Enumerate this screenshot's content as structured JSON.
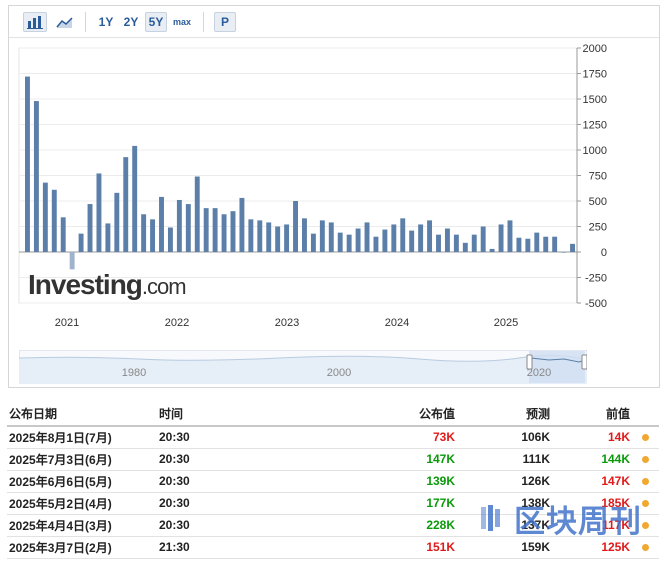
{
  "toolbar": {
    "bar_icon": "bar-chart-icon",
    "area_icon": "area-chart-icon",
    "ranges": [
      "1Y",
      "2Y",
      "5Y",
      "max"
    ],
    "active_range": "5Y",
    "p_label": "P"
  },
  "brand": {
    "name": "Investing",
    "domain": ".com"
  },
  "navigator": {
    "years": [
      "1980",
      "2000",
      "2020"
    ]
  },
  "chart_data": {
    "type": "bar",
    "x_ticks": [
      "2021",
      "2022",
      "2023",
      "2024",
      "2025"
    ],
    "ylim": [
      -500,
      2000
    ],
    "y_ticks": [
      "2000",
      "1750",
      "1500",
      "1250",
      "1000",
      "750",
      "500",
      "250",
      "0",
      "-250",
      "-500"
    ],
    "values": [
      1720,
      1480,
      680,
      610,
      340,
      -170,
      180,
      470,
      770,
      280,
      580,
      930,
      1040,
      370,
      320,
      540,
      240,
      510,
      470,
      740,
      430,
      430,
      370,
      400,
      530,
      320,
      310,
      290,
      250,
      270,
      500,
      330,
      180,
      310,
      290,
      190,
      170,
      230,
      290,
      150,
      220,
      270,
      330,
      210,
      270,
      310,
      170,
      230,
      170,
      90,
      170,
      250,
      30,
      270,
      310,
      140,
      130,
      190,
      150,
      150,
      -10,
      80
    ],
    "color_positive": "#5b7fa8",
    "color_negative": "#9fb3cc"
  },
  "table": {
    "headers": {
      "date": "公布日期",
      "time": "时间",
      "actual": "公布值",
      "forecast": "预测",
      "previous": "前值"
    },
    "rows": [
      {
        "date": "2025年8月1日(7月)",
        "time": "20:30",
        "actual": "73K",
        "actual_state": "down",
        "forecast": "106K",
        "previous": "14K",
        "previous_state": "down"
      },
      {
        "date": "2025年7月3日(6月)",
        "time": "20:30",
        "actual": "147K",
        "actual_state": "up",
        "forecast": "111K",
        "previous": "144K",
        "previous_state": "up"
      },
      {
        "date": "2025年6月6日(5月)",
        "time": "20:30",
        "actual": "139K",
        "actual_state": "up",
        "forecast": "126K",
        "previous": "147K",
        "previous_state": "down"
      },
      {
        "date": "2025年5月2日(4月)",
        "time": "20:30",
        "actual": "177K",
        "actual_state": "up",
        "forecast": "138K",
        "previous": "185K",
        "previous_state": "down"
      },
      {
        "date": "2025年4月4日(3月)",
        "time": "20:30",
        "actual": "228K",
        "actual_state": "up",
        "forecast": "137K",
        "previous": "117K",
        "previous_state": "down"
      },
      {
        "date": "2025年3月7日(2月)",
        "time": "21:30",
        "actual": "151K",
        "actual_state": "down",
        "forecast": "159K",
        "previous": "125K",
        "previous_state": "down"
      }
    ]
  },
  "watermark": {
    "text": "区块周刊"
  },
  "colors": {
    "accent": "#2b5c9a",
    "up": "#0a9a0a",
    "down": "#e01a1a",
    "dot": "#f0a830"
  }
}
